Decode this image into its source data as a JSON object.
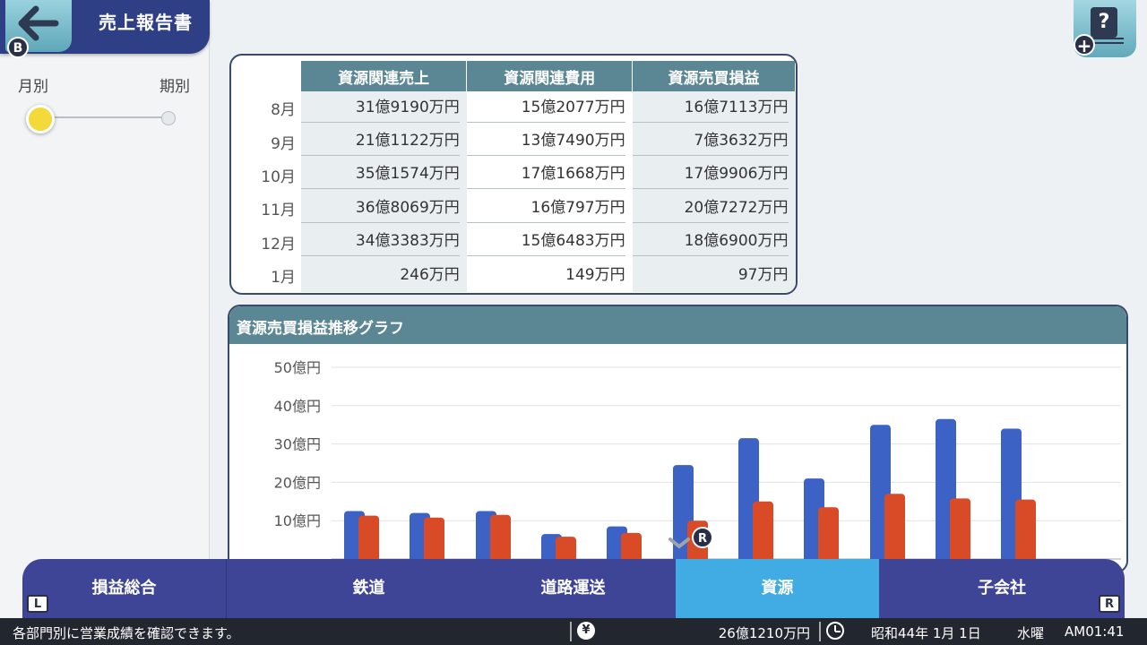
{
  "header": {
    "title": "売上報告書",
    "back_badge": "B",
    "help_label": "?",
    "help_plus": "+"
  },
  "period_toggle": {
    "left_label": "月別",
    "right_label": "期別",
    "selected": "月別"
  },
  "table": {
    "columns": [
      "資源関連売上",
      "資源関連費用",
      "資源売買損益"
    ],
    "rows": [
      {
        "month": "8月",
        "sales": "31億9190万円",
        "cost": "15億2077万円",
        "profit": "16億7113万円"
      },
      {
        "month": "9月",
        "sales": "21億1122万円",
        "cost": "13億7490万円",
        "profit": "7億3632万円"
      },
      {
        "month": "10月",
        "sales": "35億1574万円",
        "cost": "17億1668万円",
        "profit": "17億9906万円"
      },
      {
        "month": "11月",
        "sales": "36億8069万円",
        "cost": "16億797万円",
        "profit": "20億7272万円"
      },
      {
        "month": "12月",
        "sales": "34億3383万円",
        "cost": "15億6483万円",
        "profit": "18億6900万円"
      },
      {
        "month": "1月",
        "sales": "246万円",
        "cost": "149万円",
        "profit": "97万円"
      }
    ]
  },
  "chart_data": {
    "type": "bar",
    "title": "資源売買損益推移グラフ",
    "y_ticks": [
      "50億円",
      "40億円",
      "30億円",
      "20億円",
      "10億円"
    ],
    "ylim": [
      0,
      50
    ],
    "series": [
      {
        "color": "#3d62c6",
        "values": [
          12.5,
          12,
          12.5,
          6.5,
          8.5,
          24.5,
          31.5,
          21,
          35,
          36.5,
          34
        ]
      },
      {
        "color": "#d94a27",
        "values": [
          11.3,
          10.8,
          11.5,
          5.8,
          6.8,
          10,
          15,
          13.5,
          17,
          15.8,
          15.5
        ]
      }
    ],
    "grid": true,
    "marker_badge": "R"
  },
  "tabs": [
    {
      "label": "損益総合",
      "active": false
    },
    {
      "label": "鉄道",
      "active": false
    },
    {
      "label": "道路運送",
      "active": false
    },
    {
      "label": "資源",
      "active": true
    },
    {
      "label": "子会社",
      "active": false
    }
  ],
  "shoulder_badges": {
    "left": "L",
    "right": "R"
  },
  "status": {
    "message": "各部門別に営業成績を確認できます。",
    "yen_icon": "¥",
    "money": "26億1210万円",
    "date": "昭和44年 1月 1日",
    "weekday": "水曜",
    "time": "AM01:41"
  }
}
